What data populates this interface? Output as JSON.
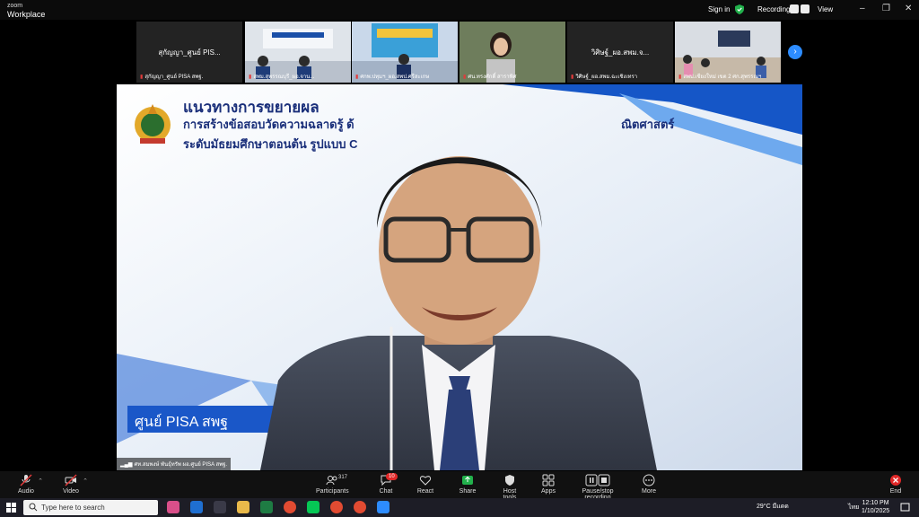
{
  "app": {
    "brand_small": "zoom",
    "brand_name": "Workplace"
  },
  "topbar": {
    "sign_in": "Sign in",
    "recording": "Recording...",
    "view": "View",
    "min": "–",
    "max": "❐",
    "close": "✕"
  },
  "thumbnails": [
    {
      "name": "สุกัญญา_ศูนย์ PIS...",
      "label": "สุกัญญา_ศูนย์ PISA สพฐ."
    },
    {
      "name": "",
      "label": "สพม.สุพรรณบุรี_ผอ.จาน..."
    },
    {
      "name": "",
      "label": "ศกพ.ปทุมฯ_ผอ.สพป.ศรีสะเกษ"
    },
    {
      "name": "",
      "label": "ศน.ทรงศักดิ์ สาราพิศ"
    },
    {
      "name": "วิศิษฐ์_ผอ.สพม.จ...",
      "label": "วิศิษฐ์_ผอ.สพม.ฉะเชิงเทรา"
    },
    {
      "name": "",
      "label": "สพป.เชียงใหม่ เขต 2 ศก.สุพรรณฯ"
    }
  ],
  "slide": {
    "title1": "แนวทางการขยายผล",
    "title2": "การสร้างข้อสอบวัดความฉลาดรู้ ด้",
    "title2b": "ณิตศาสตร์",
    "title3": "ระดับมัธยมศึกษาตอนต้น รูปแบบ C",
    "tag": "ศูนย์ PISA สพฐ"
  },
  "speaker_label": "ศท.สมพงษ์ พันธุ์ทรัพ ผอ.ศูนย์ PISA สพฐ.",
  "toolbar": {
    "audio": "Audio",
    "video": "Video",
    "participants": "Participants",
    "participants_count": "317",
    "chat": "Chat",
    "chat_badge": "10",
    "react": "React",
    "share": "Share",
    "host_tools": "Host tools",
    "apps": "Apps",
    "pause_stop": "Pause/stop recording",
    "more": "More",
    "end": "End"
  },
  "taskbar": {
    "search_placeholder": "Type here to search",
    "weather": "29°C มีแดด",
    "lang": "ไทย",
    "time": "12:10 PM",
    "date": "1/10/2025"
  },
  "colors": {
    "accent": "#2d8cff",
    "record": "#e23b3b",
    "end": "#e02828",
    "slide_title": "#1a2f7a"
  }
}
